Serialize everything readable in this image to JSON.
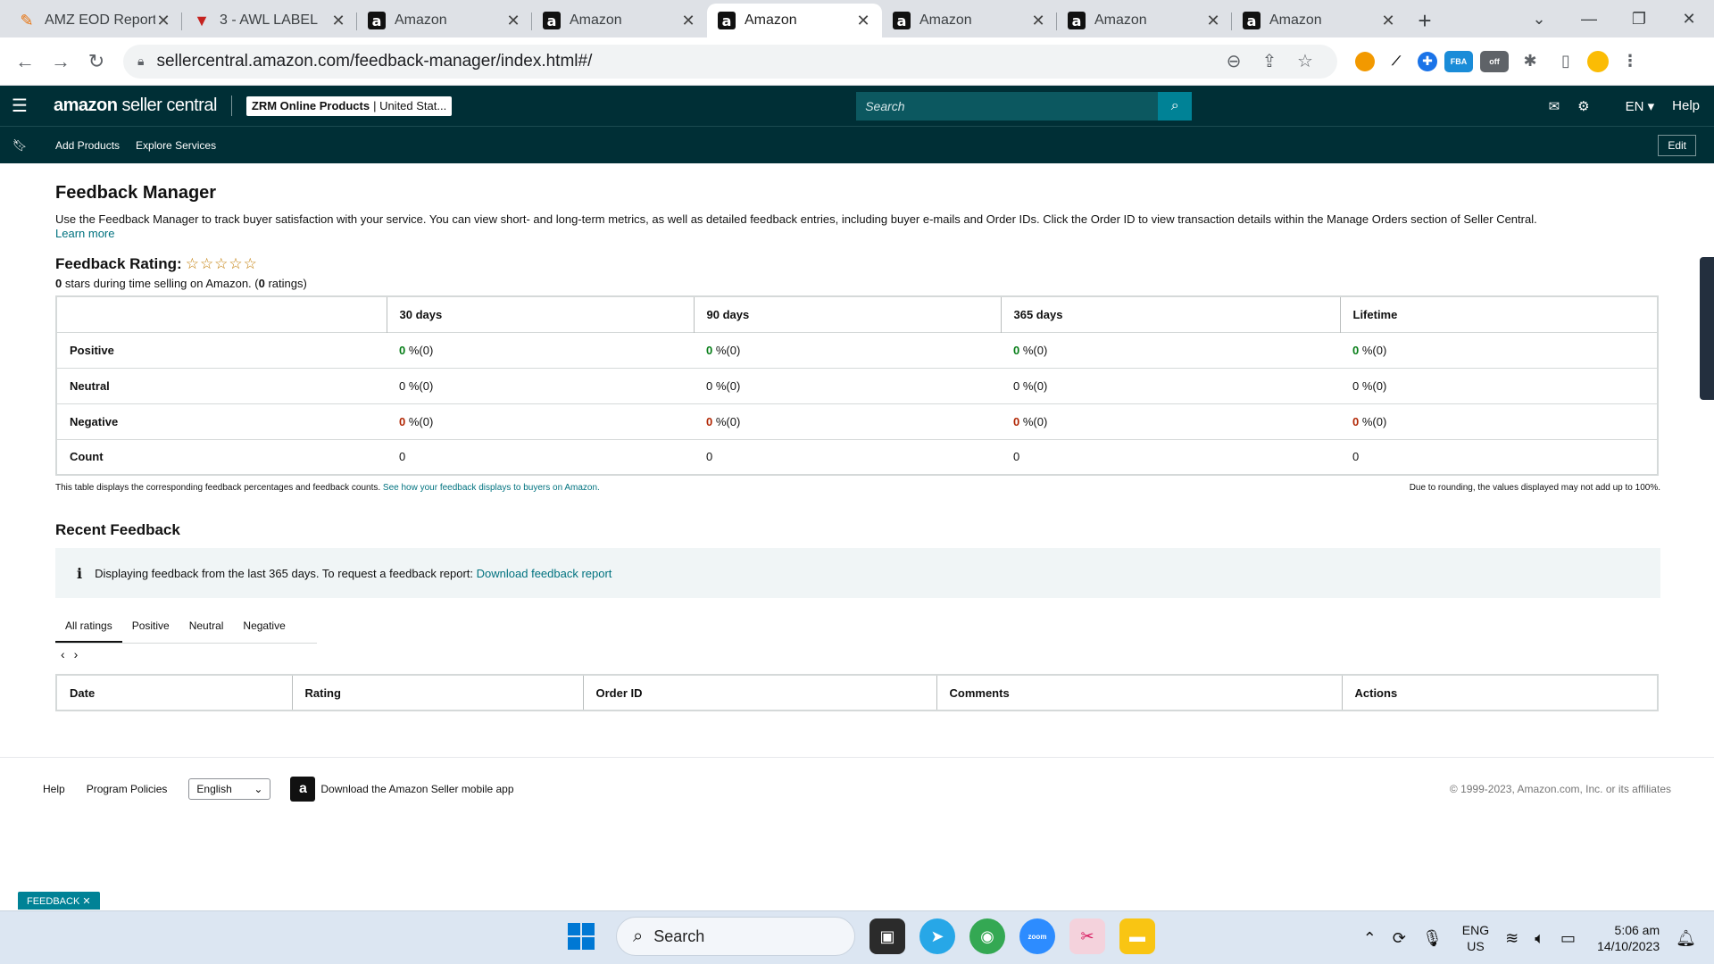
{
  "browser": {
    "tabs": [
      {
        "title": "AMZ EOD Report",
        "icon": "report-icon",
        "active": false
      },
      {
        "title": "3 - AWL LABEL",
        "icon": "label-icon",
        "active": false
      },
      {
        "title": "Amazon",
        "icon": "amazon-icon",
        "active": false
      },
      {
        "title": "Amazon",
        "icon": "amazon-icon",
        "active": false
      },
      {
        "title": "Amazon",
        "icon": "amazon-icon",
        "active": true
      },
      {
        "title": "Amazon",
        "icon": "amazon-icon",
        "active": false
      },
      {
        "title": "Amazon",
        "icon": "amazon-icon",
        "active": false
      },
      {
        "title": "Amazon",
        "icon": "amazon-icon",
        "active": false
      }
    ],
    "url": "sellercentral.amazon.com/feedback-manager/index.html#/"
  },
  "header": {
    "logo_bold": "amazon",
    "logo_rest": " seller central",
    "store_bold": "ZRM Online Products",
    "store_rest": "| United Stat...",
    "search_placeholder": "Search",
    "lang": "EN",
    "help": "Help"
  },
  "subnav": {
    "add_products": "Add Products",
    "explore_services": "Explore Services",
    "edit": "Edit"
  },
  "page": {
    "title": "Feedback Manager",
    "description": "Use the Feedback Manager to track buyer satisfaction with your service. You can view short- and long-term metrics, as well as detailed feedback entries, including buyer e-mails and Order IDs. Click the Order ID to view transaction details within the Manage Orders section of Seller Central.",
    "learn_more": "Learn more",
    "rating_label": "Feedback Rating:",
    "stars": "☆☆☆☆☆",
    "rating_stars": "0",
    "rating_mid": " stars during time selling on Amazon. (",
    "rating_count": "0",
    "rating_end": " ratings)"
  },
  "metrics": {
    "columns": [
      "30 days",
      "90 days",
      "365 days",
      "Lifetime"
    ],
    "rows": [
      {
        "label": "Positive",
        "cells": [
          {
            "n": "0",
            "s": " %(0)"
          },
          {
            "n": "0",
            "s": " %(0)"
          },
          {
            "n": "0",
            "s": " %(0)"
          },
          {
            "n": "0",
            "s": " %(0)"
          }
        ]
      },
      {
        "label": "Neutral",
        "cells": [
          {
            "n": "0",
            "s": " %(0)"
          },
          {
            "n": "0",
            "s": " %(0)"
          },
          {
            "n": "0",
            "s": " %(0)"
          },
          {
            "n": "0",
            "s": " %(0)"
          }
        ]
      },
      {
        "label": "Negative",
        "cells": [
          {
            "n": "0",
            "s": " %(0)"
          },
          {
            "n": "0",
            "s": " %(0)"
          },
          {
            "n": "0",
            "s": " %(0)"
          },
          {
            "n": "0",
            "s": " %(0)"
          }
        ]
      },
      {
        "label": "Count",
        "cells": [
          {
            "n": "0",
            "s": ""
          },
          {
            "n": "0",
            "s": ""
          },
          {
            "n": "0",
            "s": ""
          },
          {
            "n": "0",
            "s": ""
          }
        ]
      }
    ],
    "note_left": "This table displays the corresponding feedback percentages and feedback counts.",
    "note_link": "See how your feedback displays to buyers on Amazon.",
    "note_right": "Due to rounding, the values displayed may not add up to 100%."
  },
  "recent": {
    "title": "Recent Feedback",
    "info_text": "Displaying feedback from the last 365 days. To request a feedback report:",
    "info_link": "Download feedback report",
    "filters": [
      "All ratings",
      "Positive",
      "Neutral",
      "Negative"
    ],
    "columns": [
      "Date",
      "Rating",
      "Order ID",
      "Comments",
      "Actions"
    ]
  },
  "footer": {
    "help": "Help",
    "policies": "Program Policies",
    "language": "English",
    "app_text": "Download the Amazon Seller mobile app",
    "copyright": "© 1999-2023, Amazon.com, Inc. or its affiliates"
  },
  "feedback_tag": "FEEDBACK ✕",
  "taskbar": {
    "search": "Search",
    "lang_top": "ENG",
    "lang_bottom": "US",
    "time": "5:06 am",
    "date": "14/10/2023"
  },
  "colors": {
    "header_bg": "#002f36",
    "accent_teal": "#008296",
    "positive": "#067d17",
    "negative": "#b12704",
    "link": "#00727f"
  }
}
